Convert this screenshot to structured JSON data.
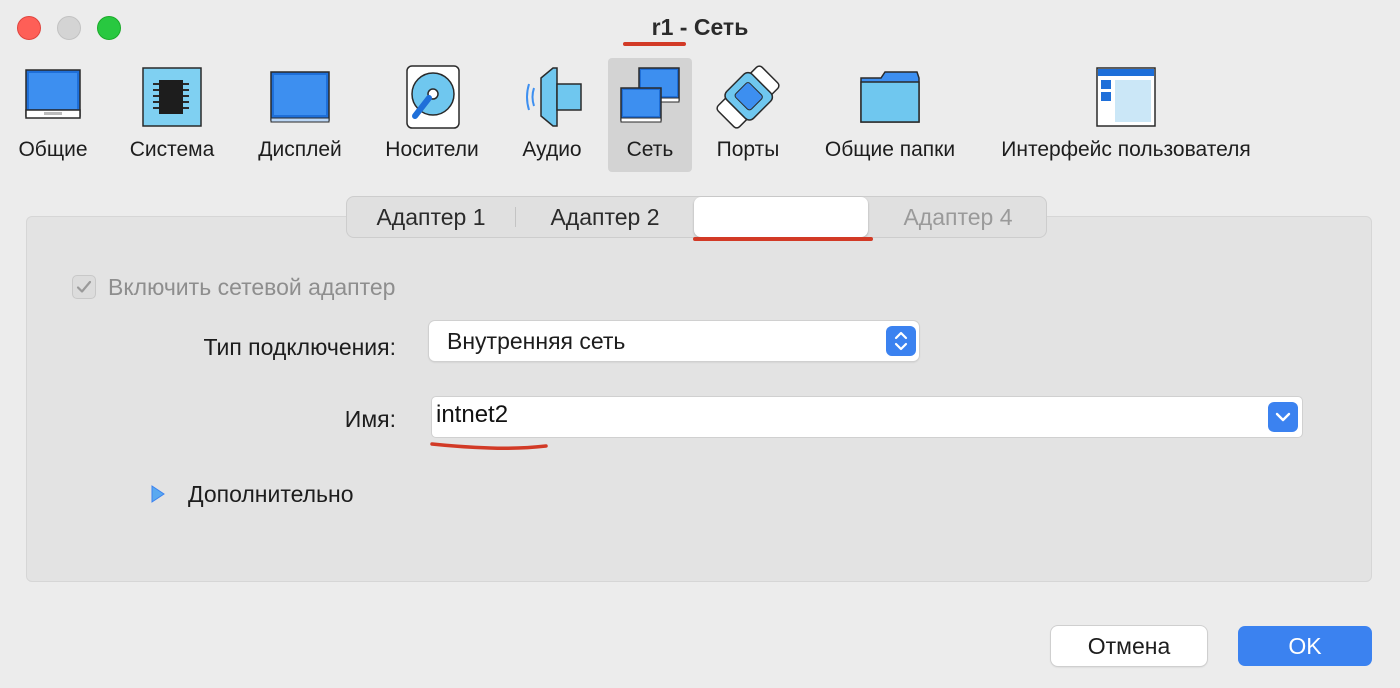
{
  "window": {
    "title": "r1 - Сеть"
  },
  "toolbar": {
    "items": [
      {
        "label": "Общие",
        "icon": "general-monitor-icon",
        "selected": false
      },
      {
        "label": "Система",
        "icon": "system-chip-icon",
        "selected": false
      },
      {
        "label": "Дисплей",
        "icon": "display-monitor-icon",
        "selected": false
      },
      {
        "label": "Носители",
        "icon": "storage-disk-icon",
        "selected": false
      },
      {
        "label": "Аудио",
        "icon": "audio-speaker-icon",
        "selected": false
      },
      {
        "label": "Сеть",
        "icon": "network-icon",
        "selected": true
      },
      {
        "label": "Порты",
        "icon": "ports-connector-icon",
        "selected": false
      },
      {
        "label": "Общие папки",
        "icon": "shared-folder-icon",
        "selected": false
      },
      {
        "label": "Интерфейс пользователя",
        "icon": "user-interface-window-icon",
        "selected": false
      }
    ]
  },
  "tabs": [
    {
      "label": "Адаптер 1",
      "state": "normal"
    },
    {
      "label": "Адаптер 2",
      "state": "normal"
    },
    {
      "label": "",
      "state": "active"
    },
    {
      "label": "Адаптер 4",
      "state": "disabled"
    }
  ],
  "form": {
    "enable_adapter": {
      "label": "Включить сетевой адаптер",
      "checked": true,
      "disabled": true
    },
    "connection_type": {
      "label": "Тип подключения:",
      "value": "Внутренняя сеть"
    },
    "name": {
      "label": "Имя:",
      "value": "intnet2"
    },
    "advanced": {
      "label": "Дополнительно",
      "expanded": false
    }
  },
  "buttons": {
    "cancel": "Отмена",
    "ok": "OK"
  },
  "colors": {
    "accent": "#3b82f0",
    "annotation": "#d23a26"
  }
}
